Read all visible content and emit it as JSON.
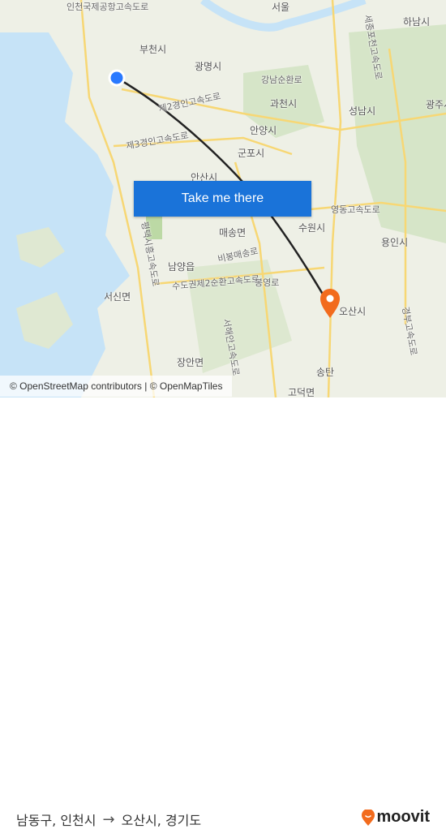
{
  "map": {
    "labels": [
      "인천국제공항고속도로",
      "부천시",
      "광명시",
      "강남순환로",
      "과천시",
      "안양시",
      "군포시",
      "제2경인고속도로",
      "제3경인고속도로",
      "수도권제2순환고속도로",
      "서해안고속도로",
      "안산시",
      "매송면",
      "비봉매송로",
      "남양읍",
      "평택시흥고속도로",
      "서신면",
      "봉영로",
      "장안면",
      "수원시",
      "영동고속도로",
      "성남시",
      "하남시",
      "용인시",
      "광주시",
      "송탄",
      "고덕면",
      "오산시",
      "세종포천고속도로",
      "경부고속도로",
      "서울"
    ],
    "colors": {
      "water": "#c6e3f7",
      "land": "#eef0e6",
      "green": "#d6e5c8",
      "road": "#f7d774",
      "route": "#222222",
      "origin": "#2979ff",
      "destination": "#f26b1d"
    }
  },
  "cta": {
    "label": "Take me there"
  },
  "attribution": "© OpenStreetMap contributors | © OpenMapTiles",
  "footer": {
    "origin": "남동구, 인천시",
    "arrow": "→",
    "destination": "오산시, 경기도"
  },
  "brand": {
    "name": "moovit",
    "color": "#f26b1d"
  }
}
